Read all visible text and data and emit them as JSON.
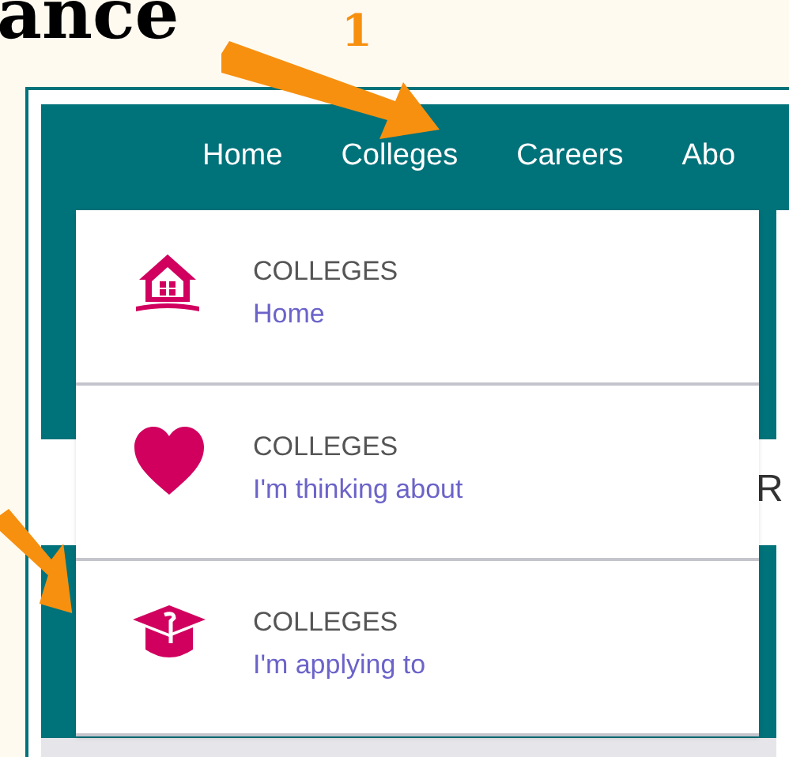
{
  "heading": "ance",
  "annotation_label": "1",
  "nav": [
    "Home",
    "Colleges",
    "Careers",
    "Abo"
  ],
  "dropdown": [
    {
      "label": "COLLEGES",
      "link": "Home"
    },
    {
      "label": "COLLEGES",
      "link": "I'm thinking about"
    },
    {
      "label": "COLLEGES",
      "link": "I'm applying to"
    }
  ],
  "background_text": "R"
}
